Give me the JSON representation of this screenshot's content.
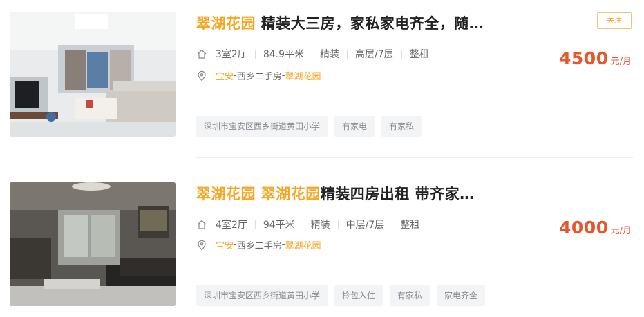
{
  "listings": [
    {
      "title_highlight": "翠湖花园",
      "title_rest": " 精装大三房，家私家电齐全，随…",
      "layout": "3室2厅",
      "area": "84.9平米",
      "decoration": "精装",
      "floor": "高层/7层",
      "rent_type": "整租",
      "location": {
        "district": "宝安",
        "dash1": "-",
        "area": "西乡二手房",
        "dash2": "-",
        "community": "翠湖花园"
      },
      "tags": [
        "深圳市宝安区西乡街道黄田小学",
        "有家电",
        "有家私"
      ],
      "follow_label": "关注",
      "price": "4500",
      "price_unit": "元/月"
    },
    {
      "title_highlight": "翠湖花园 翠湖花园",
      "title_rest": "精装四房出租 带齐家…",
      "layout": "4室2厅",
      "area": "94平米",
      "decoration": "精装",
      "floor": "中层/7层",
      "rent_type": "整租",
      "location": {
        "district": "宝安",
        "dash1": "-",
        "area": "西乡二手房",
        "dash2": "-",
        "community": "翠湖花园"
      },
      "tags": [
        "深圳市宝安区西乡街道黄田小学",
        "拎包入住",
        "有家私",
        "家电齐全"
      ],
      "price": "4000",
      "price_unit": "元/月"
    }
  ],
  "colors": {
    "accent": "#f5a623",
    "price": "#e8562c",
    "tag_bg": "#f3f4f6"
  },
  "icons": {
    "layout": "house-icon",
    "location": "map-pin-icon"
  }
}
